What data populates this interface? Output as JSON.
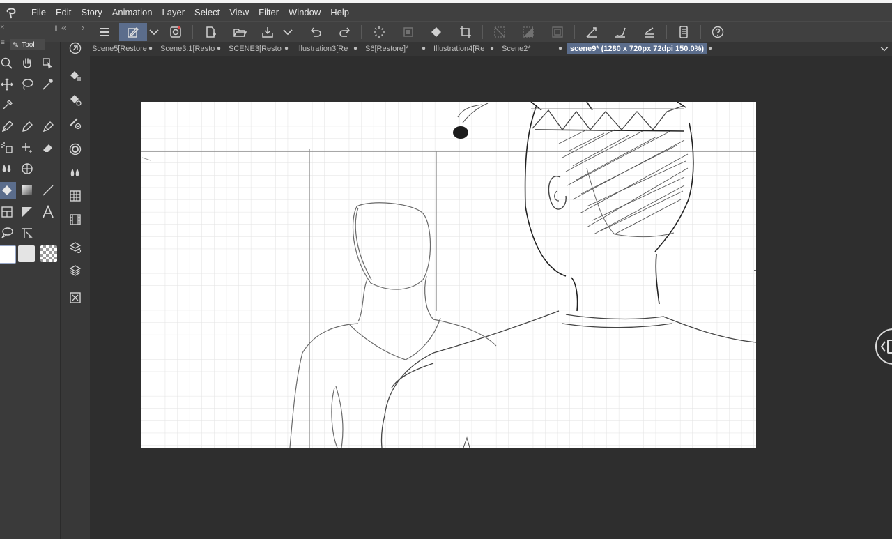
{
  "menu": {
    "items": [
      "File",
      "Edit",
      "Story",
      "Animation",
      "Layer",
      "Select",
      "View",
      "Filter",
      "Window",
      "Help"
    ]
  },
  "toolbar": {
    "buttons": [
      "menu-icon",
      "sub-tool-icon",
      "dropdown-icon",
      "navigator-icon",
      "new-icon",
      "open-icon",
      "save-icon",
      "save-dropdown-icon",
      "undo-icon",
      "redo-icon",
      "loading-icon",
      "clear-icon",
      "fill-icon",
      "crop-icon",
      "deselect-icon",
      "invert-selection-icon",
      "expand-selection-icon",
      "snap-ruler-icon",
      "snap-special-icon",
      "snap-grid-icon",
      "smartphone-icon",
      "help-icon"
    ]
  },
  "tool_panel": {
    "tab_label": "Tool",
    "collapse_left": "«",
    "collapse_right": "›",
    "panel_close": "×"
  },
  "tabs": [
    {
      "label": "Scene5[Restore",
      "active": false
    },
    {
      "label": "Scene3.1[Resto",
      "active": false
    },
    {
      "label": "SCENE3[Restor",
      "active": false
    },
    {
      "label": "Illustration3[Re",
      "active": false
    },
    {
      "label": "S6[Restore]*",
      "active": false
    },
    {
      "label": "Illustration4[Re",
      "active": false
    },
    {
      "label": "Scene2*",
      "active": false
    },
    {
      "label": "scene9* (1280 x 720px 72dpi 150.0%)",
      "active": true
    }
  ],
  "colors": {
    "accent": "#5b6d8c",
    "background": "#2e2e2e",
    "panel": "#404040",
    "canvas": "#ffffff"
  }
}
